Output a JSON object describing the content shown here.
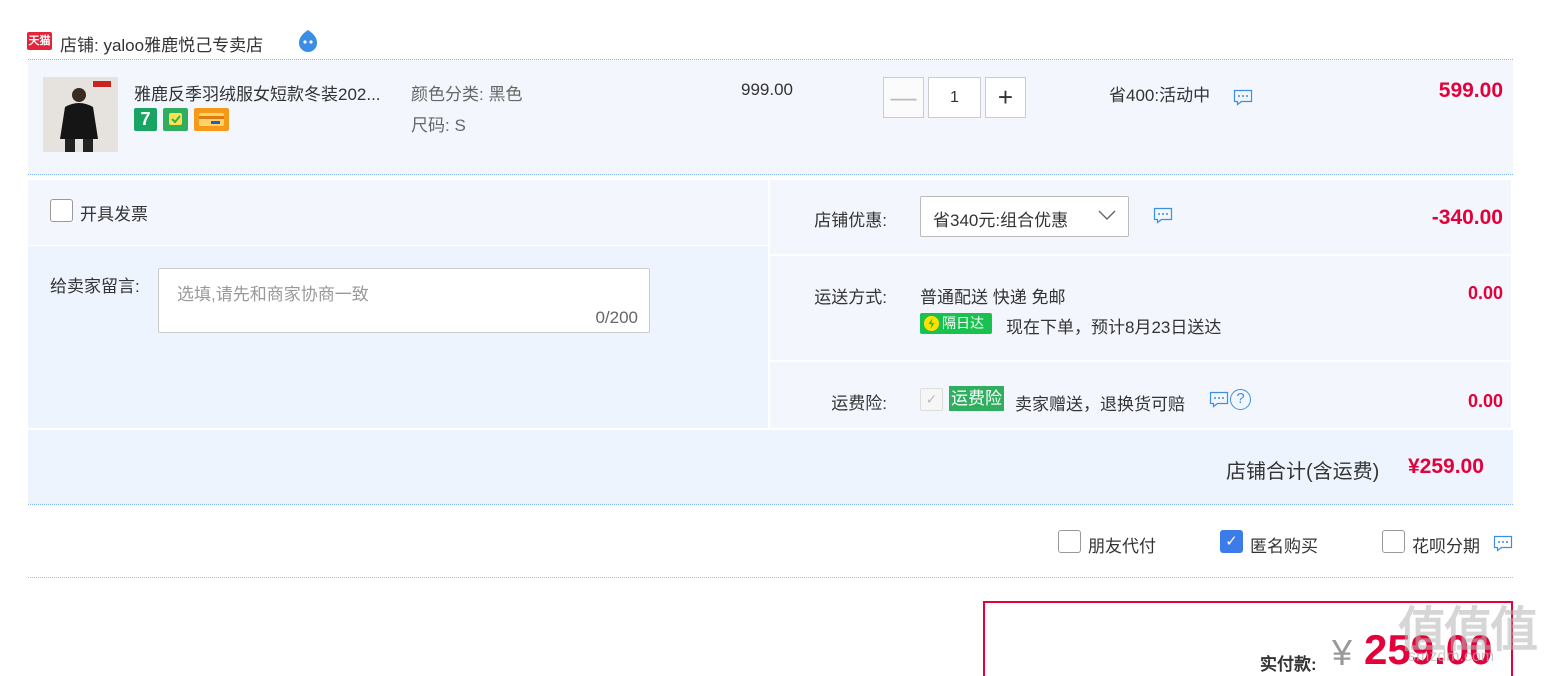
{
  "store": {
    "platform_badge": "天猫",
    "label": "店铺: yaloo雅鹿悦己专卖店"
  },
  "item": {
    "title": "雅鹿反季羽绒服女短款冬装202...",
    "sku_color": "颜色分类: 黑色",
    "sku_size": "尺码: S",
    "unit_price": "999.00",
    "quantity": "1",
    "minus_label": "—",
    "plus_label": "+",
    "promo": "省400:活动中",
    "subtotal": "599.00",
    "badge_7day": "7"
  },
  "invoice": {
    "label": "开具发票",
    "checked": false
  },
  "memo": {
    "label": "给卖家留言:",
    "placeholder": "选填,请先和商家协商一致",
    "counter": "0/200"
  },
  "store_discount": {
    "label": "店铺优惠:",
    "selected": "省340元:组合优惠",
    "amount": "-340.00"
  },
  "shipping": {
    "label": "运送方式:",
    "method": "普通配送 快递 免邮",
    "badge": "隔日达",
    "eta": "现在下单，预计8月23日送达",
    "amount": "0.00"
  },
  "insurance": {
    "label": "运费险:",
    "tag": "运费险",
    "desc": "卖家赠送，退换货可赔",
    "help": "?",
    "amount": "0.00"
  },
  "store_total": {
    "label": "店铺合计(含运费)",
    "amount": "¥259.00"
  },
  "options": {
    "friend_pay": "朋友代付",
    "anonymous": "匿名购买",
    "huabei": "花呗分期"
  },
  "payment": {
    "label": "实付款:",
    "currency": "¥",
    "amount": "259.00"
  },
  "watermark": {
    "logo": "值值值",
    "site": "smzdm.com"
  },
  "colors": {
    "accent_red": "#e4003a",
    "panel_bg": "#f3f7fd",
    "checkbox_blue": "#3b7bea",
    "nextday_green": "#19c24f"
  }
}
